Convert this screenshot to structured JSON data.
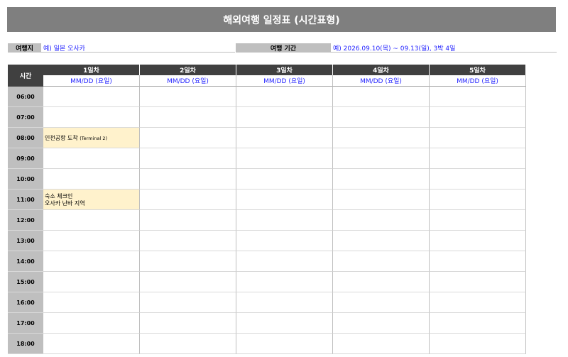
{
  "title": "해외여행 일정표 (시간표형)",
  "info": {
    "destination_label": "여행지",
    "destination_value": "예) 일본 오사카",
    "period_label": "여행 기간",
    "period_value": "예) 2026.09.10(목) ~ 09.13(일), 3박 4일"
  },
  "table": {
    "time_header": "시간",
    "days": [
      {
        "label": "1일차",
        "date": "MM/DD (요일)"
      },
      {
        "label": "2일차",
        "date": "MM/DD (요일)"
      },
      {
        "label": "3일차",
        "date": "MM/DD (요일)"
      },
      {
        "label": "4일차",
        "date": "MM/DD (요일)"
      },
      {
        "label": "5일차",
        "date": "MM/DD (요일)"
      }
    ],
    "times": [
      "06:00",
      "07:00",
      "08:00",
      "09:00",
      "10:00",
      "11:00",
      "12:00",
      "13:00",
      "14:00",
      "15:00",
      "16:00",
      "17:00",
      "18:00"
    ],
    "events": {
      "day1_0800": {
        "main": "인천공항 도착",
        "sub": "(Terminal 2)"
      },
      "day1_1100": {
        "line1": "숙소 체크인",
        "line2": "오사카 난바 지역"
      }
    }
  }
}
